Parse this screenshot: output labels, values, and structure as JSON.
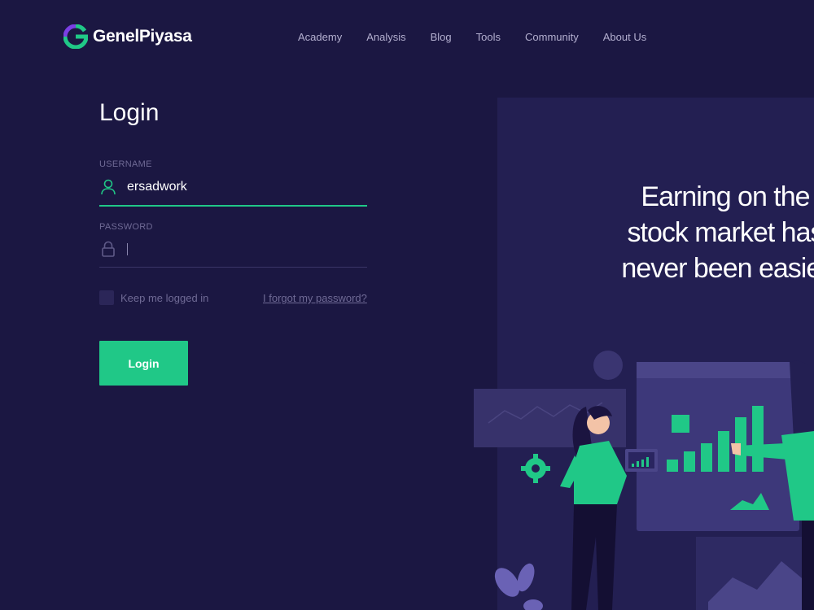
{
  "brand": {
    "name": "GenelPiyasa",
    "accent": "#20c887",
    "accent_secondary": "#7b3fe4",
    "background": "#1b1742"
  },
  "nav": {
    "items": [
      {
        "label": "Academy"
      },
      {
        "label": "Analysis"
      },
      {
        "label": "Blog"
      },
      {
        "label": "Tools"
      },
      {
        "label": "Community"
      },
      {
        "label": "About Us"
      }
    ]
  },
  "login": {
    "title": "Login",
    "username": {
      "label": "USERNAME",
      "value": "ersadwork",
      "icon": "user-icon"
    },
    "password": {
      "label": "PASSWORD",
      "value": "",
      "icon": "lock-icon"
    },
    "remember_label": "Keep me logged in",
    "remember_checked": false,
    "forgot_label": "I forgot my password?",
    "submit_label": "Login"
  },
  "hero": {
    "heading_lines": [
      "Earning on the",
      "stock market has",
      "never been easier"
    ]
  }
}
